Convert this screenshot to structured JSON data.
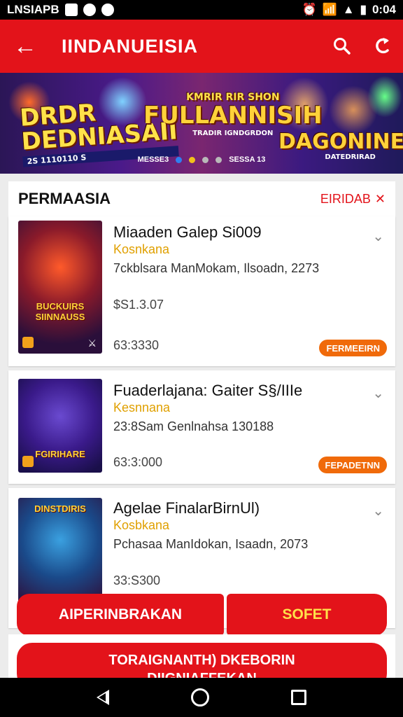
{
  "status_bar": {
    "carrier": "LNSIAPB",
    "time": "0:04"
  },
  "app_bar": {
    "title": "IINDANUEISIA"
  },
  "banner": {
    "title1": "DRDR\nDEDNIASAII",
    "title1_sub": "2S  1110110 S",
    "title2_top": "KMRIR RIR SHON",
    "title2_main": "FULLANNISIH",
    "title2_sub": "TRADIR IGNDGRDON",
    "title3": "DAGONINEH",
    "title3_sub": "DATEDRIRAD",
    "label_left": "MESSE3",
    "label_right": "SESSA 13",
    "dot_colors": [
      "#2f7ff0",
      "#f2c21b",
      "#b9b9b9",
      "#b9b9b9"
    ]
  },
  "section": {
    "title": "PERMAASIA",
    "edit_label": "EIRIDAB",
    "close_icon": "close-icon"
  },
  "items": [
    {
      "title": "Miaaden Galep Si009",
      "subtitle": "Kosnkana",
      "meta": "7ckblsara ManMokam, Ilsoadn, 2273",
      "price": "$S1.3.07",
      "time": "63:3330",
      "tag": "FERMEEIRN",
      "thumb_title": "BUCKUIRS\nSIINNAUSS"
    },
    {
      "title": "Fuaderlajana: Gaiter S§/IIIe",
      "subtitle": "Kesnnana",
      "meta": "23:8Sam Genlnahsa 130188",
      "time": "63:3:000",
      "tag": "FEPADETNN",
      "thumb_title": "FGIRIHARE"
    },
    {
      "title": "Agelae FinalarBirnUl)",
      "subtitle": "Kosbkana",
      "meta": "Pchasaa ManIdokan, Isaadn, 2073",
      "time": "33:S300",
      "thumb_title": "DINSTDIRIS"
    }
  ],
  "actions": {
    "left_button": "AIPERINBRAKAN",
    "right_button": "SOFET",
    "bottom_button_line1": "TORAIGNANTH) DKEBORIN",
    "bottom_button_line2": "DIIGNIAFFEKAN"
  }
}
